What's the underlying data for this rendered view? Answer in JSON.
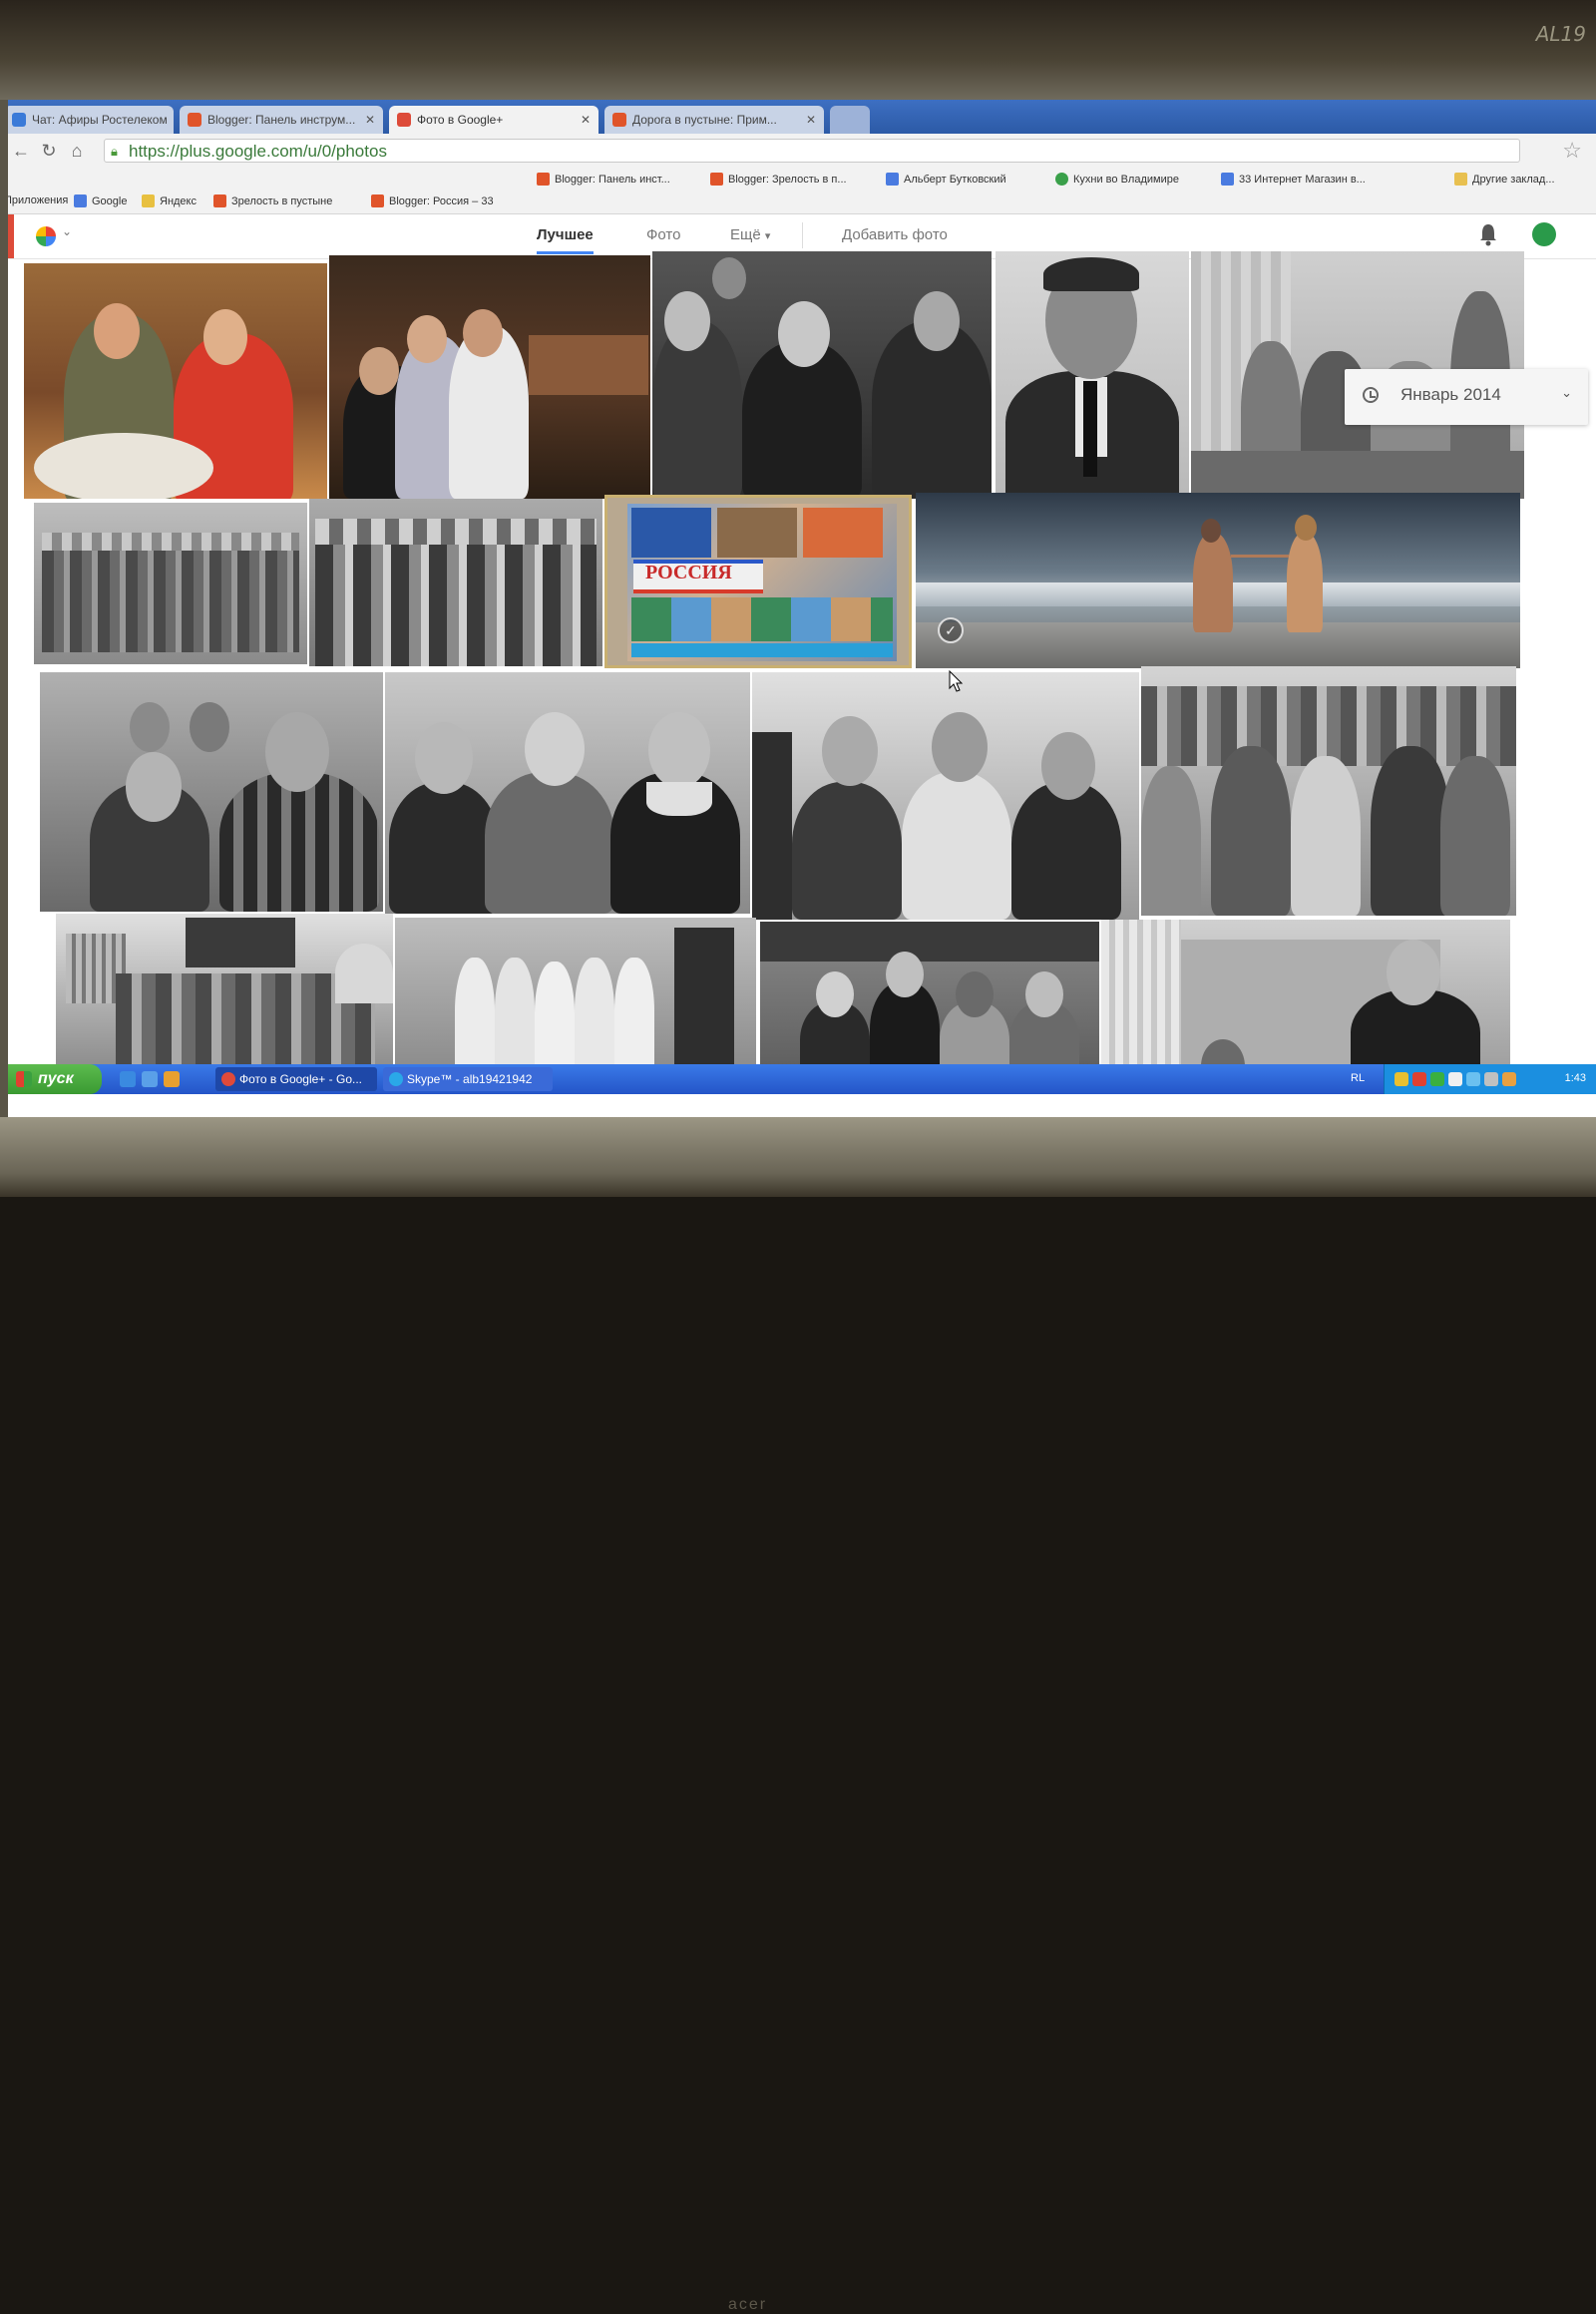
{
  "monitor": {
    "brand": "AL19",
    "bottom_label": "acer"
  },
  "browser": {
    "tabs": [
      {
        "title": "Чат: Афиры Ростелеком",
        "active": false
      },
      {
        "title": "Blogger: Панель инструм...",
        "active": false
      },
      {
        "title": "Фото в Google+",
        "active": true
      },
      {
        "title": "Дорога в пустыне: Прим...",
        "active": false
      }
    ],
    "url": "https://plus.google.com/u/0/photos",
    "bookmarks_row1": [
      {
        "label": "Blogger: Панель инст...",
        "icon": "blogger-icon"
      },
      {
        "label": "Blogger: Зрелость в п...",
        "icon": "blogger-icon"
      },
      {
        "label": "Альберт Бутковский",
        "icon": "vk-icon"
      },
      {
        "label": "Кухни во Владимире",
        "icon": "check-icon"
      },
      {
        "label": "33 Интернет Магазин в...",
        "icon": "shop-icon"
      },
      {
        "label": "Другие заклад...",
        "icon": "folder-icon"
      }
    ],
    "bookmarks_row2": [
      {
        "label": "Приложения",
        "icon": "apps-icon"
      },
      {
        "label": "Google",
        "icon": "google-icon"
      },
      {
        "label": "Яндекс",
        "icon": "yandex-icon"
      },
      {
        "label": "Зрелость в пустыне",
        "icon": "blogger-icon"
      },
      {
        "label": "Blogger: Россия – 33",
        "icon": "blogger-icon"
      }
    ]
  },
  "gplus": {
    "nav": {
      "best": "Лучшее",
      "photos": "Фото",
      "more": "Ещё",
      "add": "Добавить фото"
    },
    "date_selector": "Январь 2014",
    "collage_caption": "РОССИЯ"
  },
  "taskbar": {
    "start": "пуск",
    "tasks": [
      {
        "label": "Фото в Google+ - Go..."
      },
      {
        "label": "Skype™ - alb19421942"
      }
    ],
    "lang": "RL",
    "time": "1:43"
  },
  "colors": {
    "accent_blue": "#4285f4",
    "gplus_red": "#dd4b39",
    "xp_green": "#3a9a32",
    "xp_blue": "#2455c8"
  }
}
